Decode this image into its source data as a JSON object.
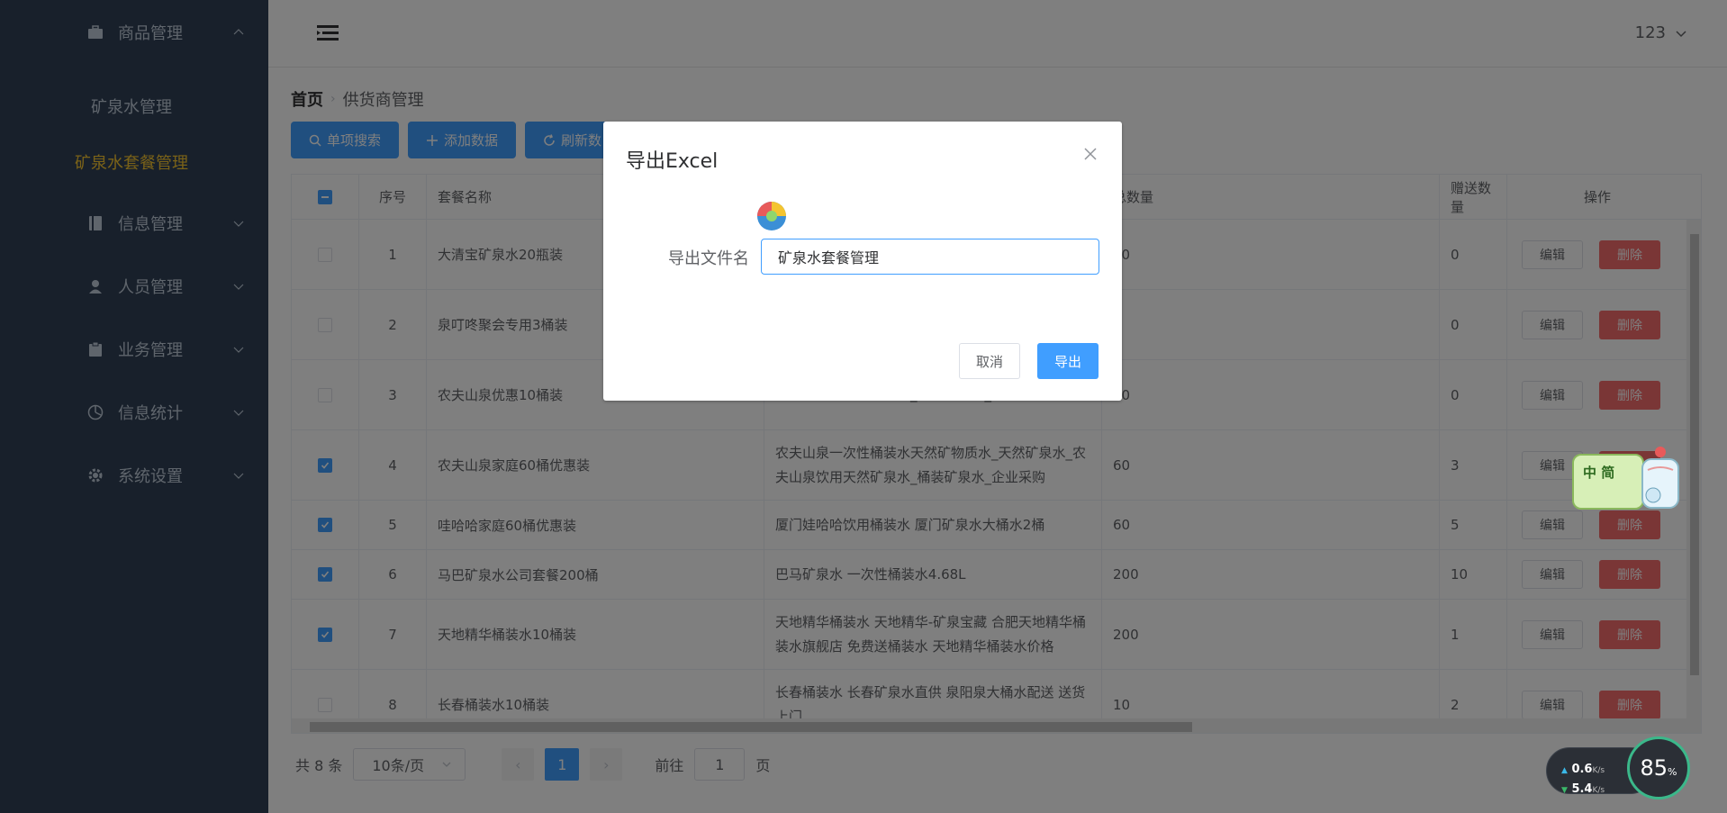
{
  "sidebar": {
    "menu": [
      {
        "label": "商品管理",
        "icon": "briefcase-icon",
        "expanded": true
      },
      {
        "label": "信息管理",
        "icon": "book-icon"
      },
      {
        "label": "人员管理",
        "icon": "user-icon"
      },
      {
        "label": "业务管理",
        "icon": "clipboard-icon"
      },
      {
        "label": "信息统计",
        "icon": "pie-chart-icon"
      },
      {
        "label": "系统设置",
        "icon": "gear-icon"
      }
    ],
    "sub_items": [
      {
        "label": "矿泉水管理",
        "active": false
      },
      {
        "label": "矿泉水套餐管理",
        "active": true
      }
    ]
  },
  "header": {
    "user_label": "123"
  },
  "breadcrumb": {
    "home": "首页",
    "current": "供货商管理"
  },
  "toolbar": {
    "search_label": "单项搜索",
    "add_label": "添加数据",
    "refresh_label": "刷新数"
  },
  "table": {
    "columns": {
      "index": "序号",
      "name": "套餐名称",
      "total": "总数量",
      "gift": "赠送数量",
      "action": "操作"
    },
    "rows": [
      {
        "checked": false,
        "index": "1",
        "name": "大清宝矿泉水20瓶装",
        "desc_line1": "",
        "desc_line2": "",
        "total": "20",
        "gift": "0"
      },
      {
        "checked": false,
        "index": "2",
        "name": "泉叮咚聚会专用3桶装",
        "desc_line1": "",
        "desc_line2": "",
        "total": "",
        "gift": "0"
      },
      {
        "checked": false,
        "index": "3",
        "name": "农夫山泉优惠10桶装",
        "desc_line1": "",
        "desc_line2": "夫山泉饮用天然矿泉水_桶装矿泉水_企业采购",
        "total": "10",
        "gift": "0"
      },
      {
        "checked": true,
        "index": "4",
        "name": "农夫山泉家庭60桶优惠装",
        "desc_line1": "农夫山泉一次性桶装水天然矿物质水_天然矿泉水_农",
        "desc_line2": "夫山泉饮用天然矿泉水_桶装矿泉水_企业采购",
        "total": "60",
        "gift": "3"
      },
      {
        "checked": true,
        "index": "5",
        "name": "哇哈哈家庭60桶优惠装",
        "desc_line1": "厦门娃哈哈饮用桶装水 厦门矿泉水大桶水2桶",
        "desc_line2": "",
        "total": "60",
        "gift": "5"
      },
      {
        "checked": true,
        "index": "6",
        "name": "马巴矿泉水公司套餐200桶",
        "desc_line1": "巴马矿泉水 一次性桶装水4.68L",
        "desc_line2": "",
        "total": "200",
        "gift": "10"
      },
      {
        "checked": true,
        "index": "7",
        "name": "天地精华桶装水10桶装",
        "desc_line1": "天地精华桶装水 天地精华-矿泉宝藏 合肥天地精华桶",
        "desc_line2": "装水旗舰店 免费送桶装水 天地精华桶装水价格",
        "total": "200",
        "gift": "1"
      },
      {
        "checked": false,
        "index": "8",
        "name": "长春桶装水10桶装",
        "desc_line1": "长春桶装水 长春矿泉水直供 泉阳泉大桶水配送 送货",
        "desc_line2": "上门",
        "total": "10",
        "gift": "2"
      }
    ],
    "edit_label": "编辑",
    "delete_label": "删除"
  },
  "pagination": {
    "total_text": "共 8 条",
    "page_size": "10条/页",
    "current_page": "1",
    "goto_prefix": "前往",
    "goto_value": "1",
    "goto_suffix": "页"
  },
  "dialog": {
    "title": "导出Excel",
    "field_label": "导出文件名",
    "field_value": "矿泉水套餐管理",
    "cancel_label": "取消",
    "confirm_label": "导出"
  },
  "widgets": {
    "ime_text": "中 简",
    "upload_speed": "0.6",
    "download_speed": "5.4",
    "speed_unit": "K/s",
    "cpu_percent": "85",
    "percent_sign": "%"
  },
  "colors": {
    "sidebar_bg": "#304156",
    "active_menu": "#f4c430",
    "primary": "#409eff",
    "danger": "#f56c6c"
  }
}
